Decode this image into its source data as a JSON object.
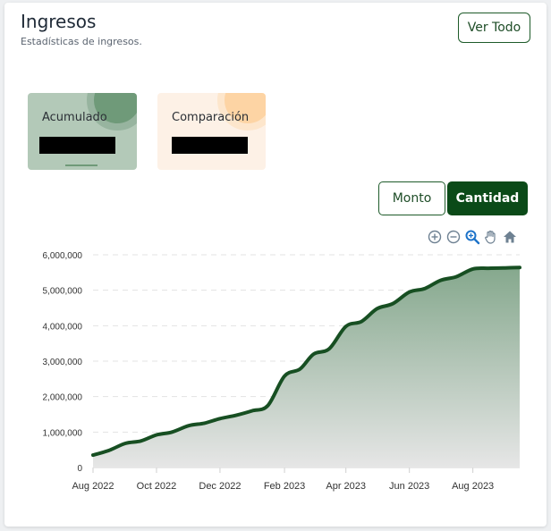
{
  "header": {
    "title": "Ingresos",
    "subtitle": "Estadísticas de ingresos.",
    "view_all": "Ver Todo"
  },
  "stats": [
    {
      "label": "Acumulado"
    },
    {
      "label": "Comparación"
    }
  ],
  "toggle": {
    "monto": "Monto",
    "cantidad": "Cantidad",
    "active": "Cantidad"
  },
  "toolbar_icons": [
    "zoom-in-icon",
    "zoom-out-icon",
    "zoom-selection-icon",
    "pan-hand-icon",
    "home-reset-icon"
  ],
  "colors": {
    "accent": "#0b4a18",
    "line": "#174f22",
    "area_top": "#85a88d",
    "area_bottom": "#e6e6e6"
  },
  "chart_data": {
    "type": "area",
    "x_ticks": [
      "Aug 2022",
      "Oct 2022",
      "Dec 2022",
      "Feb 2023",
      "Apr 2023",
      "Jun 2023",
      "Aug 2023"
    ],
    "y_ticks": [
      "0",
      "1,000,000",
      "2,000,000",
      "3,000,000",
      "4,000,000",
      "5,000,000",
      "6,000,000"
    ],
    "ylim": [
      0,
      6000000
    ],
    "xlim": [
      "2022-08-01",
      "2023-09-15"
    ],
    "grid": true,
    "legend": "none",
    "series": [
      {
        "points": [
          [
            "2022-08-01",
            350000
          ],
          [
            "2022-08-16",
            480000
          ],
          [
            "2022-09-01",
            680000
          ],
          [
            "2022-09-16",
            750000
          ],
          [
            "2022-10-01",
            920000
          ],
          [
            "2022-10-16",
            1000000
          ],
          [
            "2022-11-01",
            1180000
          ],
          [
            "2022-11-16",
            1250000
          ],
          [
            "2022-12-01",
            1380000
          ],
          [
            "2022-12-16",
            1470000
          ],
          [
            "2023-01-01",
            1600000
          ],
          [
            "2023-01-16",
            1750000
          ],
          [
            "2023-02-01",
            2580000
          ],
          [
            "2023-02-16",
            2780000
          ],
          [
            "2023-03-01",
            3200000
          ],
          [
            "2023-03-16",
            3350000
          ],
          [
            "2023-04-01",
            3980000
          ],
          [
            "2023-04-16",
            4120000
          ],
          [
            "2023-05-01",
            4480000
          ],
          [
            "2023-05-16",
            4620000
          ],
          [
            "2023-06-01",
            4950000
          ],
          [
            "2023-06-16",
            5050000
          ],
          [
            "2023-07-01",
            5280000
          ],
          [
            "2023-07-16",
            5380000
          ],
          [
            "2023-08-01",
            5600000
          ],
          [
            "2023-08-16",
            5620000
          ],
          [
            "2023-09-01",
            5630000
          ],
          [
            "2023-09-15",
            5640000
          ]
        ]
      }
    ]
  }
}
